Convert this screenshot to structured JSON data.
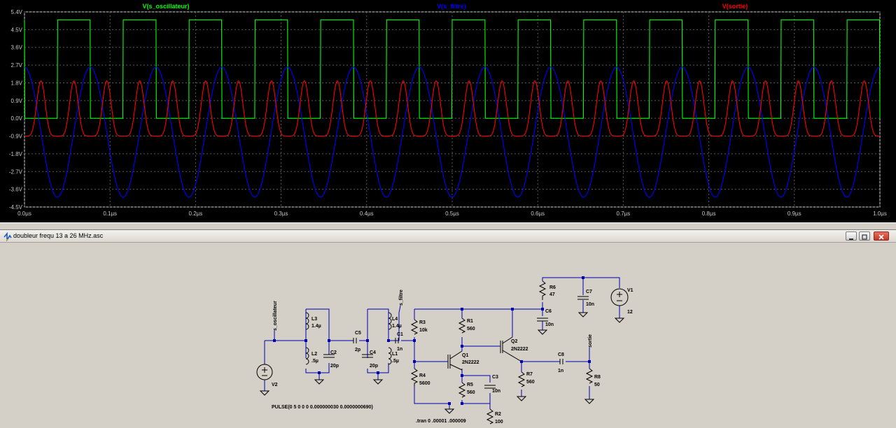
{
  "plot": {
    "traces": [
      {
        "name": "V(s_oscillateur)",
        "color": "#00ff00"
      },
      {
        "name": "V(s_filtre)",
        "color": "#0000ff"
      },
      {
        "name": "V(sortie)",
        "color": "#ff0000"
      }
    ],
    "y_ticks": [
      "5.4V",
      "4.5V",
      "3.6V",
      "2.7V",
      "1.8V",
      "0.9V",
      "0.0V",
      "-0.9V",
      "-1.8V",
      "-2.7V",
      "-3.6V",
      "-4.5V"
    ],
    "x_ticks": [
      "0.0µs",
      "0.1µs",
      "0.2µs",
      "0.3µs",
      "0.4µs",
      "0.5µs",
      "0.6µs",
      "0.7µs",
      "0.8µs",
      "0.9µs",
      "1.0µs"
    ],
    "grid_color": "#5a5a5a",
    "axis_text_color": "#c8c8c8"
  },
  "chart_data": {
    "type": "line",
    "xlabel": "",
    "ylabel": "",
    "xlim": [
      0,
      1.0
    ],
    "ylim": [
      -4.5,
      5.4
    ],
    "grid": true,
    "legend": "top",
    "series": [
      {
        "name": "V(s_oscillateur)",
        "kind": "pulse",
        "low": 0,
        "high": 5,
        "period_us": 0.0769,
        "width_us": 0.0385,
        "delay_us": 0.0385
      },
      {
        "name": "V(s_filtre)",
        "kind": "sine",
        "amplitude": 3.3,
        "offset": -0.7,
        "period_us": 0.0769
      },
      {
        "name": "V(sortie)",
        "kind": "rectified",
        "max": 1.9,
        "min": -0.9,
        "period_us": 0.0385
      }
    ]
  },
  "window": {
    "title": "doubleur frequ 13 a 26 MHz.asc"
  },
  "schematic": {
    "labels": {
      "s_oscillateur": "s_oscillateur",
      "s_filtre": "s_filtre",
      "sortie": "sortie",
      "L3": "L3",
      "L3v": "1.4µ",
      "L2": "L2",
      "L2v": ".5µ",
      "C2": "C2",
      "C2v": "20p",
      "C5": "C5",
      "C5v": "2p",
      "C4": "C4",
      "C4v": "20p",
      "L4": "L4",
      "L4v": "1.4µ",
      "L1": "L1",
      "L1v": ".5µ",
      "C1": "C1",
      "C1v": "1n",
      "R3": "R3",
      "R3v": "10k",
      "R4": "R4",
      "R4v": "5600",
      "R1": "R1",
      "R1v": "560",
      "Q1": "Q1",
      "Q1v": "2N2222",
      "Q2": "Q2",
      "Q2v": "2N2222",
      "R5": "R5",
      "R5v": "560",
      "C3": "C3",
      "C3v": "10n",
      "R2": "R2",
      "R2v": "100",
      "R6": "R6",
      "R6v": "47",
      "C6": "C6",
      "C6v": "10n",
      "C7": "C7",
      "C7v": "10n",
      "V1": "V1",
      "V1v": "12",
      "R7": "R7",
      "R7v": "560",
      "C8": "C8",
      "C8v": "1n",
      "R8": "R8",
      "R8v": "50",
      "V2": "V2",
      "pulse": "PULSE(0 5 0 0 0 0.000000030 0.0000000690)",
      "tran": ".tran 0 .00001 .000009"
    }
  }
}
